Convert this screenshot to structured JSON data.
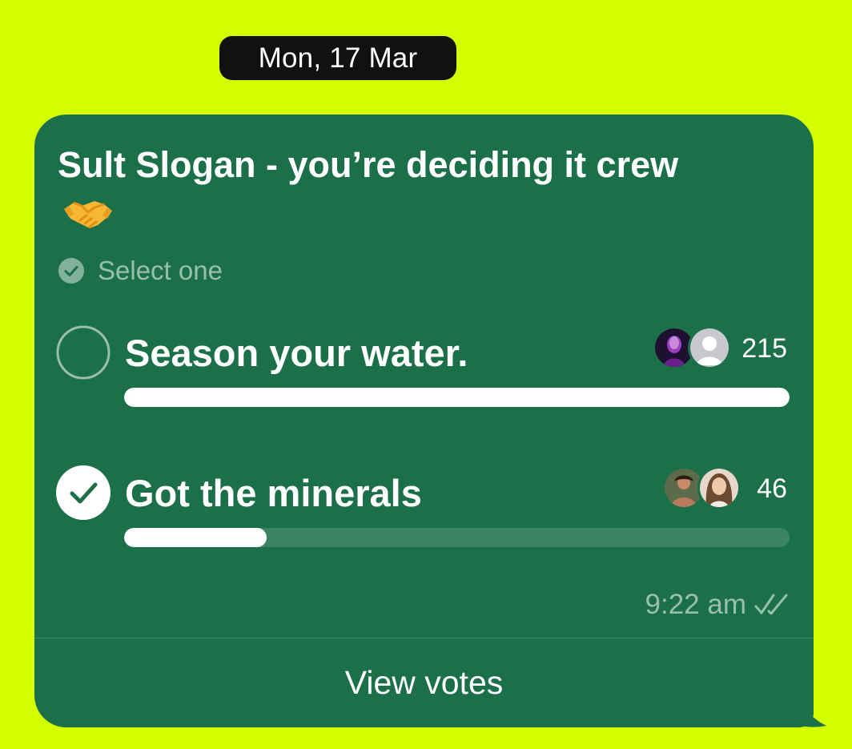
{
  "date_separator": "Mon, 17 Mar",
  "poll": {
    "title": "Sult Slogan - you’re deciding it crew",
    "title_emoji": "handshake-emoji",
    "subtitle": "Select one",
    "options": [
      {
        "label": "Season your water.",
        "votes": "215",
        "selected": false,
        "share": 1.0,
        "avatars": [
          "voter-avatar-photo",
          "default-user-avatar"
        ]
      },
      {
        "label": "Got the minerals",
        "votes": "46",
        "selected": true,
        "share": 0.214,
        "avatars": [
          "voter-avatar-photo",
          "voter-avatar-photo"
        ]
      }
    ],
    "time": "9:22 am",
    "read_status": "double-check-icon",
    "view_votes_label": "View votes"
  },
  "colors": {
    "background": "#d4ff00",
    "bubble": "#1b7049",
    "date_pill": "#111111"
  }
}
